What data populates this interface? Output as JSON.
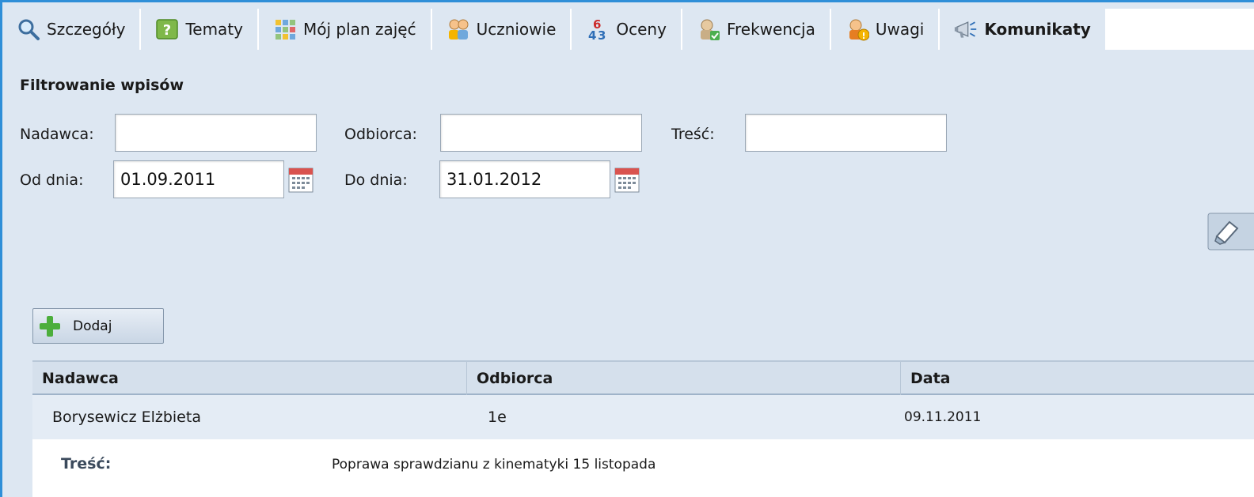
{
  "tabs": [
    {
      "label": "Szczegóły",
      "icon": "magnifier-icon"
    },
    {
      "label": "Tematy",
      "icon": "question-book-icon"
    },
    {
      "label": "Mój plan zajęć",
      "icon": "schedule-grid-icon"
    },
    {
      "label": "Uczniowie",
      "icon": "students-icon"
    },
    {
      "label": "Oceny",
      "icon": "grades-icon"
    },
    {
      "label": "Frekwencja",
      "icon": "attendance-icon"
    },
    {
      "label": "Uwagi",
      "icon": "remarks-icon"
    },
    {
      "label": "Komunikaty",
      "icon": "megaphone-icon",
      "active": true
    }
  ],
  "filter": {
    "title": "Filtrowanie wpisów",
    "sender_label": "Nadawca:",
    "sender_value": "",
    "recipient_label": "Odbiorca:",
    "recipient_value": "",
    "content_label": "Treść:",
    "content_value": "",
    "from_label": "Od dnia:",
    "from_value": "01.09.2011",
    "to_label": "Do dnia:",
    "to_value": "31.01.2012"
  },
  "add_button": {
    "label": "Dodaj"
  },
  "table": {
    "headers": [
      "Nadawca",
      "Odbiorca",
      "Data"
    ],
    "rows": [
      {
        "sender": "Borysewicz Elżbieta",
        "recipient": "1e",
        "date": "09.11.2011"
      }
    ],
    "detail_label": "Treść:",
    "detail_value": "Poprawa sprawdzianu z kinematyki 15 listopada"
  },
  "colors": {
    "frame_border": "#2f8fd8",
    "background": "#dde7f2",
    "header_bg": "#d5e0ec"
  }
}
